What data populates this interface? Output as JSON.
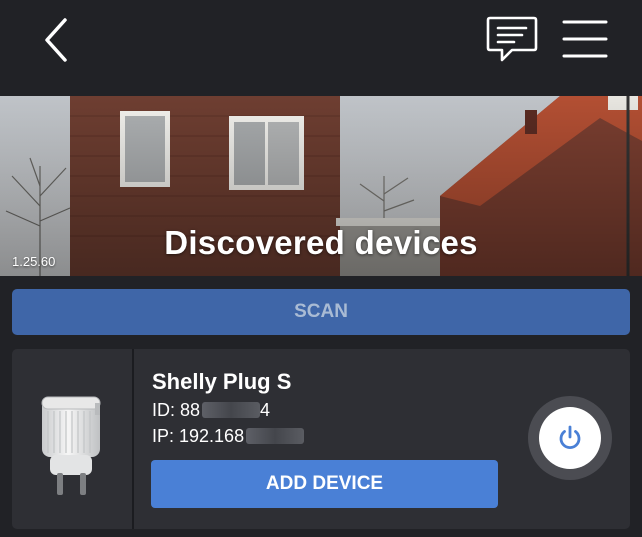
{
  "header": {
    "back_icon": "chevron-left-icon",
    "chat_icon": "chat-bubble-icon",
    "menu_icon": "hamburger-menu-icon"
  },
  "hero": {
    "title": "Discovered devices",
    "version": "1.25.60"
  },
  "scan_button": {
    "label": "SCAN"
  },
  "device": {
    "name": "Shelly Plug S",
    "id_label": "ID: 88",
    "id_suffix": "4",
    "ip_label": "IP: 192.168",
    "add_label": "ADD DEVICE",
    "power_icon": "power-icon"
  },
  "colors": {
    "background": "#212226",
    "card": "#2e2f34",
    "scan_button": "#3f66a8",
    "add_button": "#4a80d6",
    "power_icon": "#4a80d6"
  }
}
